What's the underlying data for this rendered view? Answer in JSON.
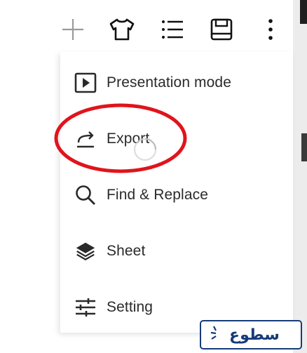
{
  "toolbar": {
    "icons": [
      "plus-icon",
      "shirt-icon",
      "list-icon",
      "save-icon",
      "more-vert-icon"
    ]
  },
  "menu": {
    "items": [
      {
        "label": "Presentation mode",
        "icon": "play-box-icon"
      },
      {
        "label": "Export",
        "icon": "export-icon"
      },
      {
        "label": "Find & Replace",
        "icon": "search-icon"
      },
      {
        "label": "Sheet",
        "icon": "layers-icon"
      },
      {
        "label": "Setting",
        "icon": "sliders-icon"
      }
    ]
  },
  "annotation": {
    "highlight_color": "#e0141c"
  },
  "watermark": {
    "text": "سطوع",
    "color": "#163b7a"
  },
  "colors": {
    "icon": "#2a2a2a",
    "toolbar_plus": "#9a9a9a",
    "menu_background": "#ffffff"
  }
}
